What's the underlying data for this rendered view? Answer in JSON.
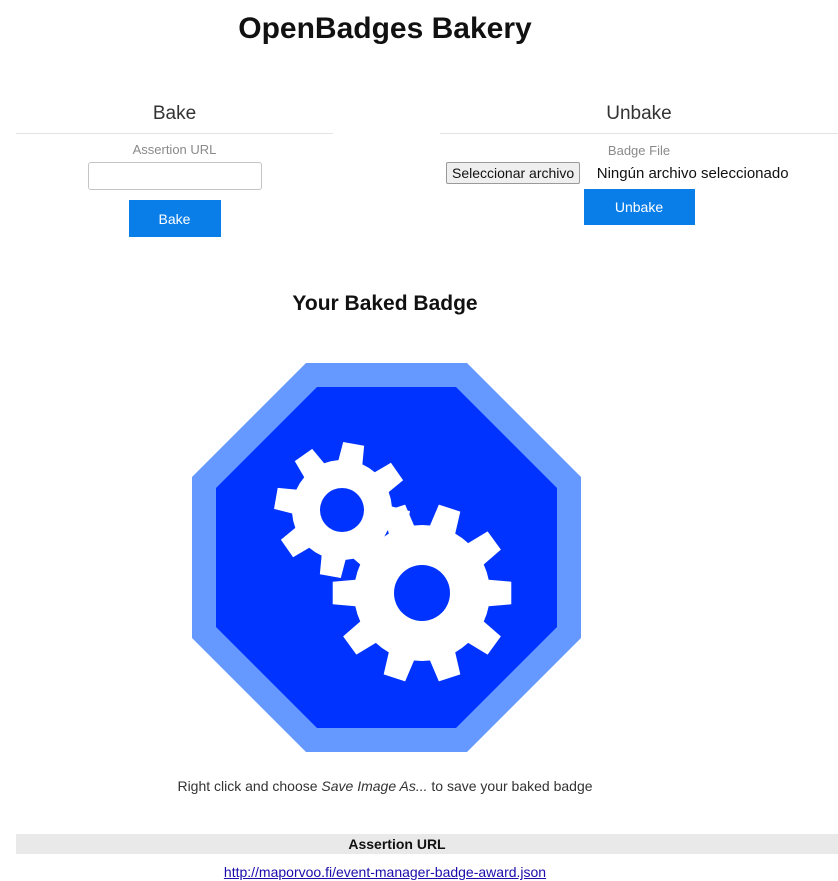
{
  "page": {
    "title": "OpenBadges Bakery"
  },
  "bake": {
    "heading": "Bake",
    "field_label": "Assertion URL",
    "input_value": "",
    "button_label": "Bake"
  },
  "unbake": {
    "heading": "Unbake",
    "field_label": "Badge File",
    "file_button_label": "Seleccionar archivo",
    "file_status": "Ningún archivo seleccionado",
    "button_label": "Unbake"
  },
  "result": {
    "heading": "Your Baked Badge",
    "badge_icon": "gears-icon",
    "badge_colors": {
      "outer": "#6699ff",
      "inner": "#0033ff",
      "gear": "#ffffff"
    },
    "instructions_prefix": "Right click and choose ",
    "instructions_emphasis": "Save Image As...",
    "instructions_suffix": " to save your baked badge",
    "info_header": "Assertion URL",
    "assertion_link": "http://maporvoo.fi/event-manager-badge-award.json"
  },
  "colors": {
    "primary_button": "#0a7ee8",
    "link": "#1a0dab"
  }
}
